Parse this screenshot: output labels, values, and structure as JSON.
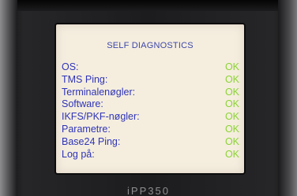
{
  "screen": {
    "title": "SELF DIAGNOSTICS",
    "checks": [
      {
        "label": "OS:",
        "status": "OK"
      },
      {
        "label": "TMS Ping:",
        "status": "OK"
      },
      {
        "label": "Terminalenøgler:",
        "status": "OK"
      },
      {
        "label": "Software:",
        "status": "OK"
      },
      {
        "label": "IKFS/PKF-nøgler:",
        "status": "OK"
      },
      {
        "label": "Parametre:",
        "status": "OK"
      },
      {
        "label": "Base24 Ping:",
        "status": "OK"
      },
      {
        "label": "Log på:",
        "status": "OK"
      }
    ]
  },
  "device": {
    "model": "iPP350"
  },
  "colors": {
    "title": "#3d47a8",
    "label": "#2e33b8",
    "ok": "#8bd334",
    "screen_bg": "#f5eedf"
  }
}
